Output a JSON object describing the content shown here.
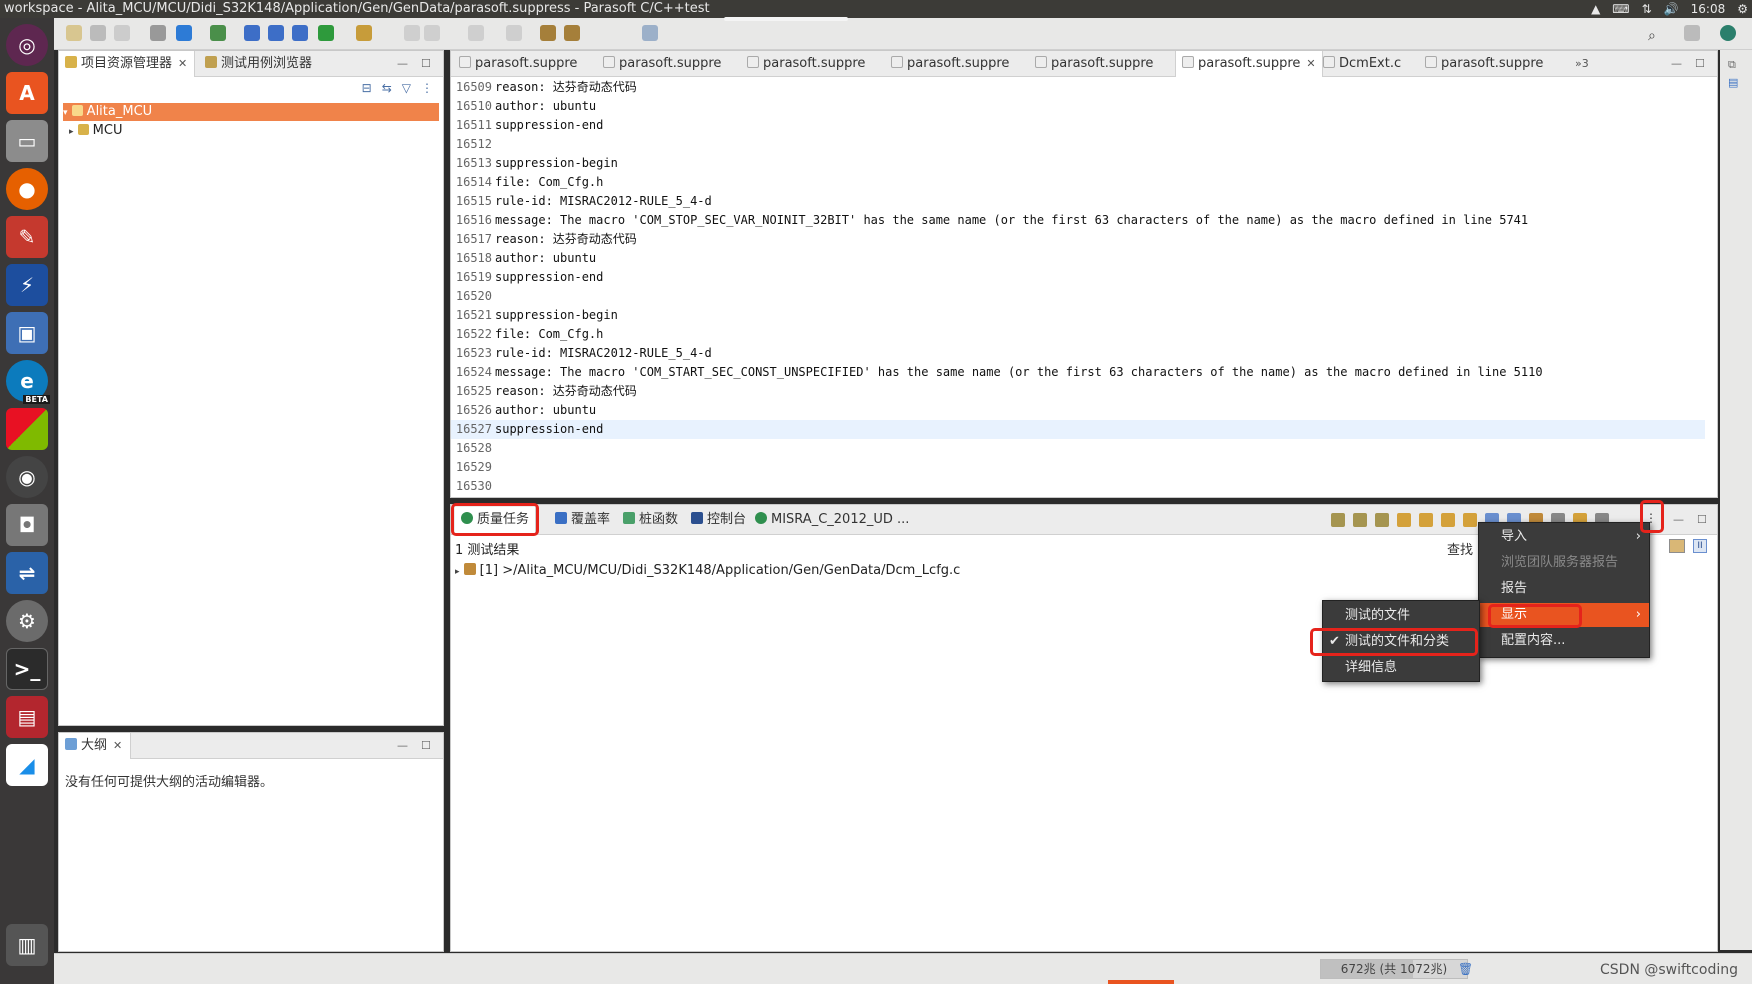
{
  "window": {
    "title": "workspace - Alita_MCU/MCU/Didi_S32K148/Application/Gen/GenData/parasoft.suppress - Parasoft C/C++test",
    "clock": "16:08"
  },
  "launcher": {
    "icons": [
      "ubuntu-dash-icon",
      "software-center-icon",
      "files-icon",
      "firefox-icon",
      "settings-tool-icon",
      "parasoft-icon",
      "virtualbox-icon",
      "edge-beta-icon",
      "colored-blocks-icon",
      "disk-utility-icon",
      "camera-icon",
      "network-icon",
      "system-settings-icon",
      "terminal-icon",
      "red-app-icon",
      "feishu-icon",
      "trash-icon"
    ],
    "beta_label": "BETA"
  },
  "project_explorer": {
    "tabs": [
      {
        "label": "项目资源管理器"
      },
      {
        "label": "测试用例浏览器"
      }
    ],
    "tree": [
      {
        "label": "Alita_MCU",
        "selected": true
      },
      {
        "label": "MCU",
        "selected": false
      }
    ]
  },
  "outline": {
    "tab_label": "大纲",
    "message": "没有任何可提供大纲的活动编辑器。"
  },
  "editor": {
    "tabs": [
      {
        "label": "parasoft.suppre",
        "active": false
      },
      {
        "label": "parasoft.suppre",
        "active": false
      },
      {
        "label": "parasoft.suppre",
        "active": false
      },
      {
        "label": "parasoft.suppre",
        "active": false
      },
      {
        "label": "parasoft.suppre",
        "active": false
      },
      {
        "label": "parasoft.suppre",
        "active": true
      },
      {
        "label": "DcmExt.c",
        "active": false
      },
      {
        "label": "parasoft.suppre",
        "active": false
      }
    ],
    "overflow_label": "»3",
    "lines": [
      {
        "n": "16509",
        "text": "reason: 达芬奇动态代码"
      },
      {
        "n": "16510",
        "text": "author: ubuntu"
      },
      {
        "n": "16511",
        "text": "suppression-end"
      },
      {
        "n": "16512",
        "text": ""
      },
      {
        "n": "16513",
        "text": "suppression-begin"
      },
      {
        "n": "16514",
        "text": "file: Com_Cfg.h"
      },
      {
        "n": "16515",
        "text": "rule-id: MISRAC2012-RULE_5_4-d"
      },
      {
        "n": "16516",
        "text": "message: The macro 'COM_STOP_SEC_VAR_NOINIT_32BIT' has the same name (or the first 63 characters of the name) as the macro defined in line 5741"
      },
      {
        "n": "16517",
        "text": "reason: 达芬奇动态代码"
      },
      {
        "n": "16518",
        "text": "author: ubuntu"
      },
      {
        "n": "16519",
        "text": "suppression-end"
      },
      {
        "n": "16520",
        "text": ""
      },
      {
        "n": "16521",
        "text": "suppression-begin"
      },
      {
        "n": "16522",
        "text": "file: Com_Cfg.h"
      },
      {
        "n": "16523",
        "text": "rule-id: MISRAC2012-RULE_5_4-d"
      },
      {
        "n": "16524",
        "text": "message: The macro 'COM_START_SEC_CONST_UNSPECIFIED' has the same name (or the first 63 characters of the name) as the macro defined in line 5110"
      },
      {
        "n": "16525",
        "text": "reason: 达芬奇动态代码"
      },
      {
        "n": "16526",
        "text": "author: ubuntu"
      },
      {
        "n": "16527",
        "text": "suppression-end",
        "current": true
      },
      {
        "n": "16528",
        "text": ""
      },
      {
        "n": "16529",
        "text": ""
      },
      {
        "n": "16530",
        "text": ""
      }
    ]
  },
  "bottom_panel": {
    "tabs": [
      {
        "label": "质量任务"
      },
      {
        "label": "覆盖率"
      },
      {
        "label": "桩函数"
      },
      {
        "label": "控制台"
      },
      {
        "label": "MISRA_C_2012_UD ..."
      }
    ],
    "results_header": "1 测试结果",
    "find_label": "查找",
    "result_row": "[1] >/Alita_MCU/MCU/Didi_S32K148/Application/Gen/GenData/Dcm_Lcfg.c"
  },
  "view_menu": {
    "items": [
      {
        "label": "导入",
        "disabled": false,
        "submenu": true
      },
      {
        "label": "浏览团队服务器报告",
        "disabled": true,
        "submenu": false
      },
      {
        "label": "报告",
        "disabled": false,
        "submenu": false
      },
      {
        "label": "显示",
        "disabled": false,
        "submenu": true,
        "highlighted": true
      },
      {
        "label": "配置内容...",
        "disabled": false,
        "submenu": false
      }
    ]
  },
  "show_submenu": {
    "items": [
      {
        "label": "测试的文件",
        "checked": false
      },
      {
        "label": "测试的文件和分类",
        "checked": true
      },
      {
        "label": "详细信息",
        "checked": false
      }
    ]
  },
  "status_bar": {
    "heap_text": "672兆 (共 1072兆)",
    "heap_used_fraction": 0.627,
    "watermark": "CSDN @swiftcoding"
  },
  "colors": {
    "accent": "#e95420",
    "selection": "#f0834a",
    "highlight_box": "#e5231b",
    "menu_bg": "#3b3b3b"
  }
}
